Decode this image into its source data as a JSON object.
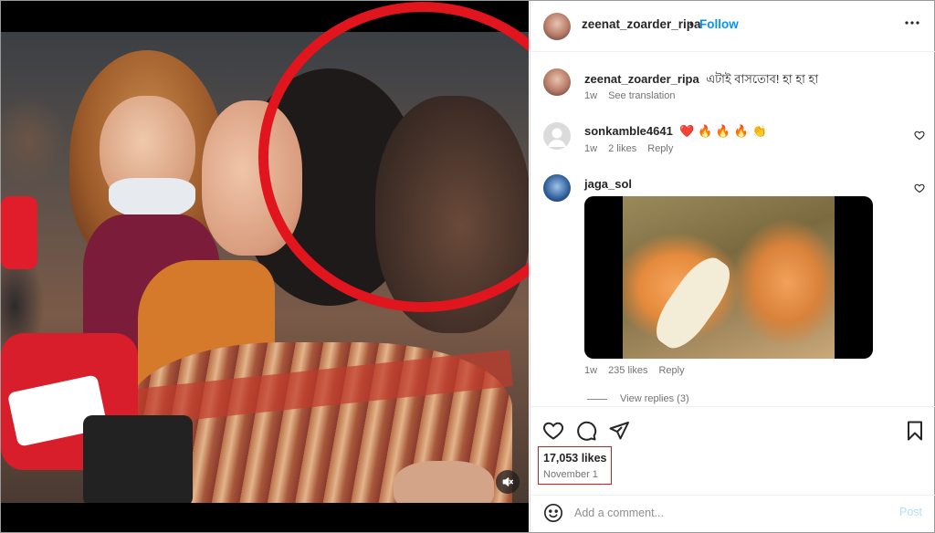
{
  "post": {
    "author": "zeenat_zoarder_ripa",
    "separator": "•",
    "follow_label": "Follow",
    "more_icon": "more-horizontal-icon"
  },
  "media": {
    "mute_icon": "speaker-muted-icon",
    "highlight_color": "#e0151d"
  },
  "comments": [
    {
      "user": "zeenat_zoarder_ripa",
      "text": "এটাই বাসতোব! হা হা হা",
      "time": "1w",
      "action": "See translation",
      "is_caption": true
    },
    {
      "user": "sonkamble4641",
      "text": "❤️ 🔥 🔥 🔥 👏",
      "time": "1w",
      "likes": "2 likes",
      "reply": "Reply"
    },
    {
      "user": "jaga_sol",
      "text": "",
      "time": "1w",
      "likes": "235 likes",
      "reply": "Reply",
      "has_gif": true
    }
  ],
  "view_replies": "View replies (3)",
  "actions": {
    "like_icon": "heart-icon",
    "comment_icon": "comment-icon",
    "share_icon": "send-icon",
    "save_icon": "bookmark-icon"
  },
  "stats": {
    "likes": "17,053 likes",
    "date": "November 1"
  },
  "add_comment": {
    "placeholder": "Add a comment...",
    "post_label": "Post",
    "emoji_icon": "emoji-icon"
  },
  "colors": {
    "link_blue": "#0095f6",
    "post_disabled": "#b2dffc",
    "secondary_text": "#737373",
    "annotation_red": "#e0151d"
  }
}
